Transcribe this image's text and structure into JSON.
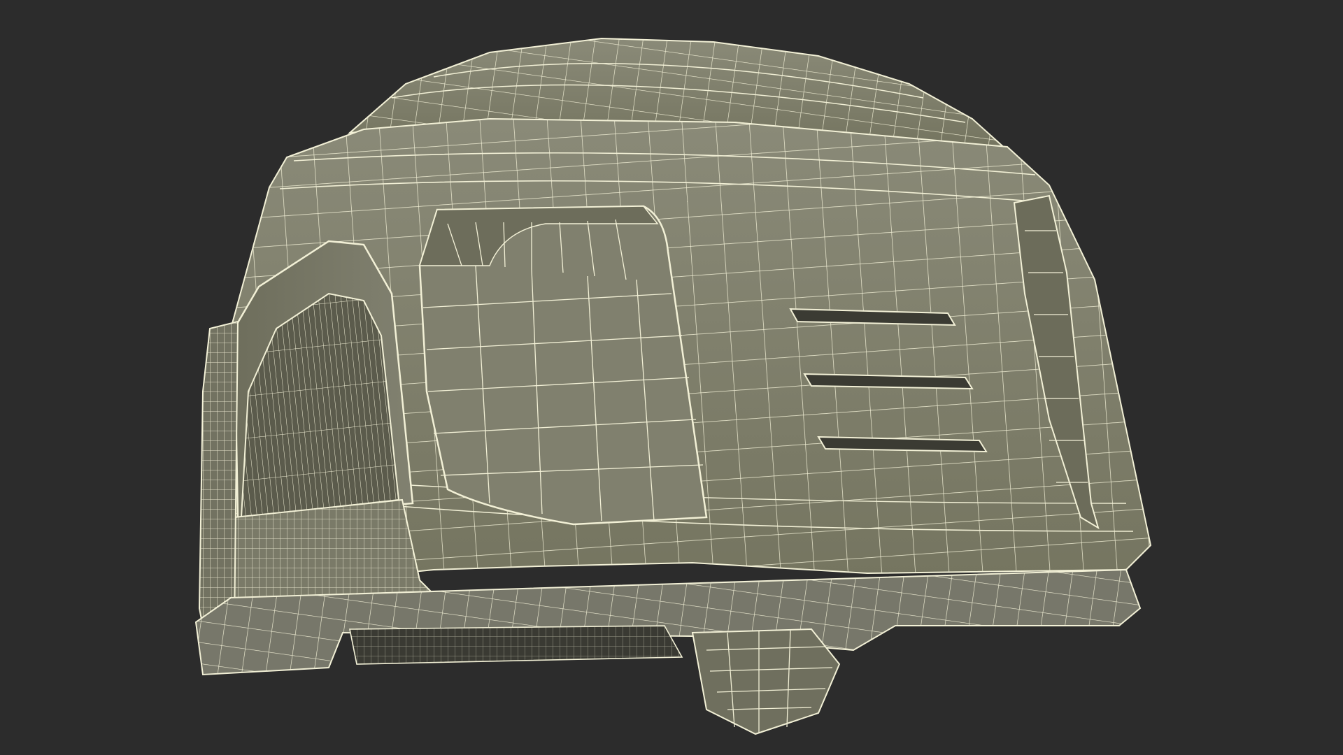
{
  "scene": {
    "subject": "wireframe-model",
    "background_color": "#2c2c2c",
    "surface_color": "#7d7d6c",
    "surface_shadow_color": "#5e5e50",
    "wire_color": "#f2f0d6"
  }
}
